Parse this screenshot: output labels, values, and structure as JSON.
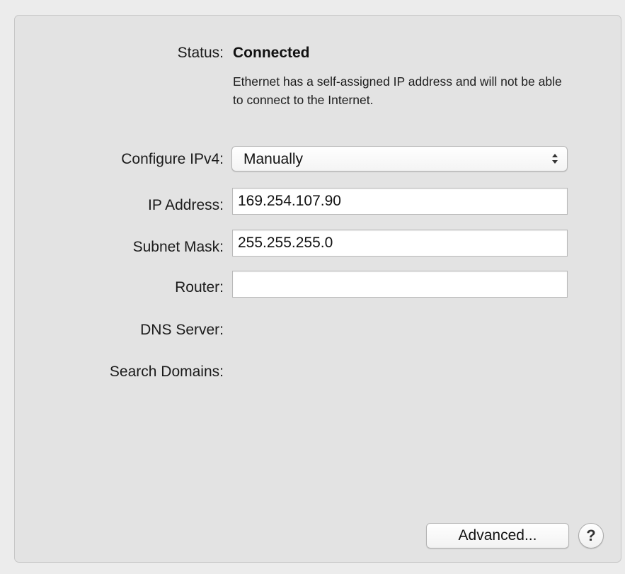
{
  "status": {
    "label": "Status:",
    "value": "Connected",
    "description": "Ethernet has a self-assigned IP address and will not be able to connect to the Internet."
  },
  "configure_ipv4": {
    "label": "Configure IPv4:",
    "selected": "Manually"
  },
  "ip_address": {
    "label": "IP Address:",
    "value": "169.254.107.90"
  },
  "subnet_mask": {
    "label": "Subnet Mask:",
    "value": "255.255.255.0"
  },
  "router": {
    "label": "Router:",
    "value": ""
  },
  "dns_server": {
    "label": "DNS Server:"
  },
  "search_domains": {
    "label": "Search Domains:"
  },
  "buttons": {
    "advanced_label": "Advanced...",
    "help_label": "?"
  },
  "icons": {
    "select_arrows": "up-down-arrows-icon"
  }
}
